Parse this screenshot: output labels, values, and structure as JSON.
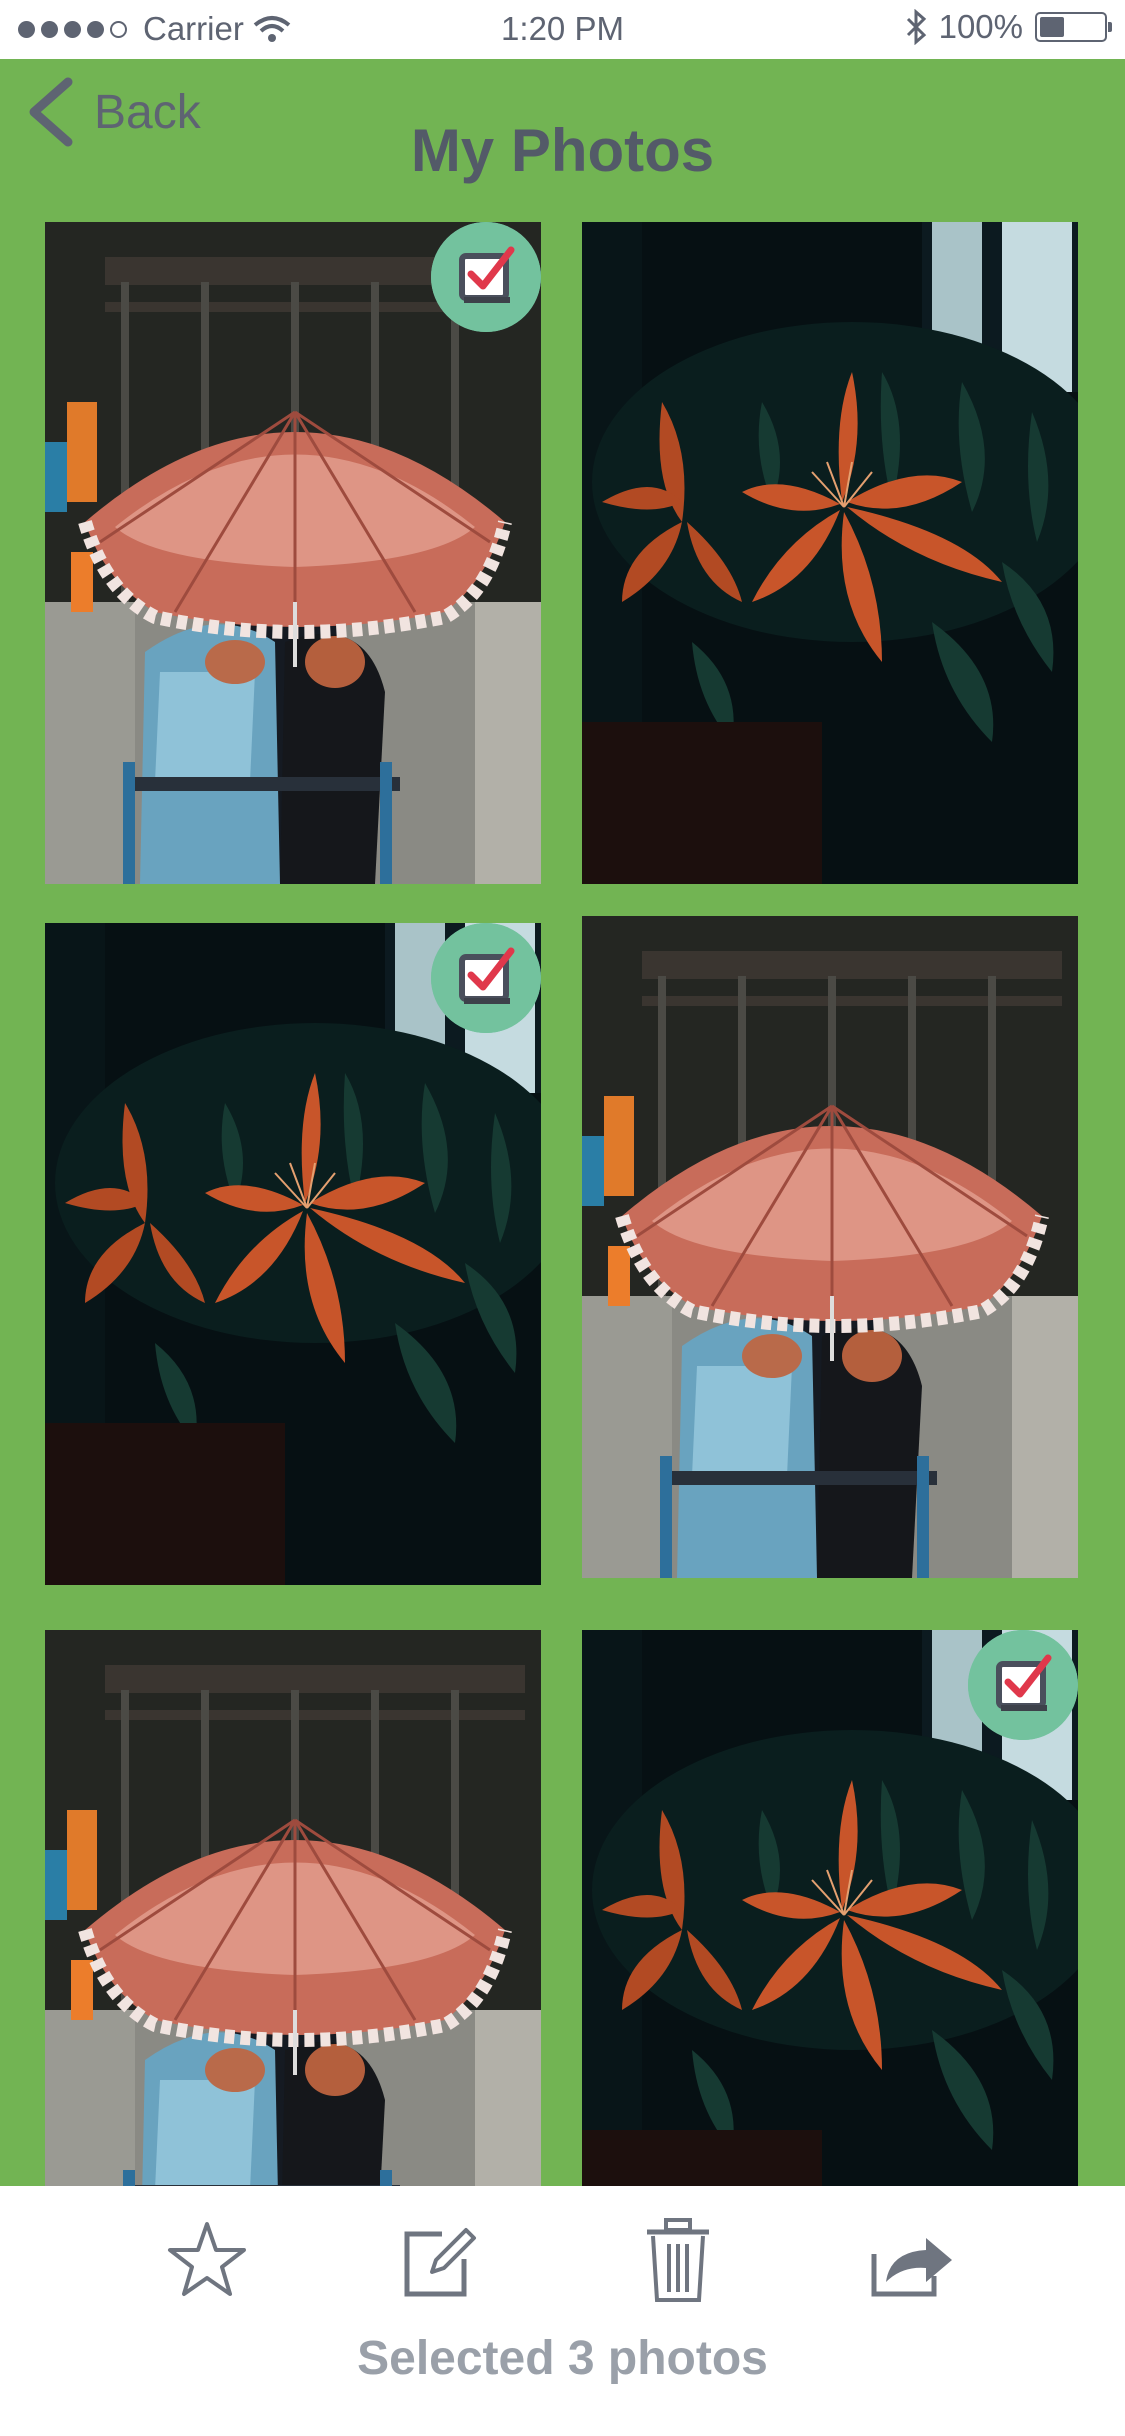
{
  "status_bar": {
    "carrier": "Carrier",
    "time": "1:20 PM",
    "battery": "100%",
    "signal_icon": "signal-dots-icon",
    "wifi_icon": "wifi-icon",
    "bluetooth_icon": "bluetooth-icon",
    "battery_icon": "battery-icon"
  },
  "nav": {
    "back_label": "Back",
    "title": "My Photos",
    "back_icon": "chevron-left-icon"
  },
  "photos": [
    {
      "subject": "umbrella",
      "selected": true
    },
    {
      "subject": "lily",
      "selected": false
    },
    {
      "subject": "lily",
      "selected": true
    },
    {
      "subject": "umbrella",
      "selected": false
    },
    {
      "subject": "umbrella",
      "selected": false
    },
    {
      "subject": "lily",
      "selected": true
    }
  ],
  "toolbar": {
    "icons": [
      "star-icon",
      "edit-icon",
      "trash-icon",
      "share-icon"
    ],
    "selection_text": "Selected 3 photos"
  },
  "colors": {
    "background": "#72b453",
    "check_badge": "#73c29e",
    "check_mark": "#e0384b",
    "text": "#535a68"
  }
}
